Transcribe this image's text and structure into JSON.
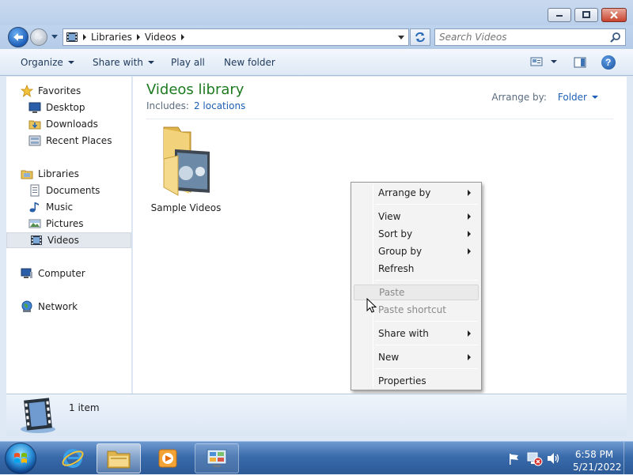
{
  "window": {
    "breadcrumb": [
      "Libraries",
      "Videos"
    ],
    "search_placeholder": "Search Videos"
  },
  "commandbar": {
    "organize": "Organize",
    "share_with": "Share with",
    "play_all": "Play all",
    "new_folder": "New folder"
  },
  "navpane": {
    "favorites": "Favorites",
    "desktop": "Desktop",
    "downloads": "Downloads",
    "recent_places": "Recent Places",
    "libraries": "Libraries",
    "documents": "Documents",
    "music": "Music",
    "pictures": "Pictures",
    "videos": "Videos",
    "computer": "Computer",
    "network": "Network"
  },
  "content": {
    "title": "Videos library",
    "includes_label": "Includes:",
    "includes_link": "2 locations",
    "arrange_label": "Arrange by:",
    "arrange_value": "Folder",
    "items": [
      {
        "label": "Sample Videos"
      }
    ]
  },
  "context_menu": {
    "arrange_by": "Arrange by",
    "view": "View",
    "sort_by": "Sort by",
    "group_by": "Group by",
    "refresh": "Refresh",
    "paste": "Paste",
    "paste_shortcut": "Paste shortcut",
    "share_with": "Share with",
    "new": "New",
    "properties": "Properties"
  },
  "details": {
    "count": "1 item"
  },
  "taskbar": {
    "time": "6:58 PM",
    "date": "5/21/2022"
  },
  "colors": {
    "library_title": "#1e7a20",
    "link": "#1c5fb4",
    "taskbar": "#3a6bab"
  }
}
